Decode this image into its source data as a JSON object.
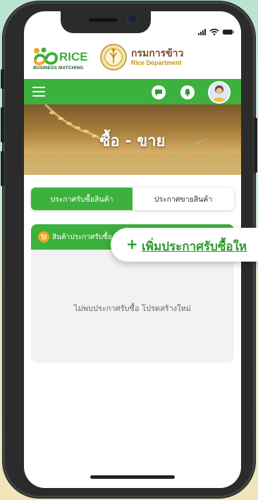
{
  "branding": {
    "rice_word": "RICE",
    "rice_subtitle": "BUSINESS MATCHING",
    "dept_name_th": "กรมการข้าว",
    "dept_name_en": "Rice Department"
  },
  "header": {
    "page_title": "ซื้อ - ขาย"
  },
  "tabs": [
    {
      "label": "ประกาศรับซื้อสินค้า",
      "active": true
    },
    {
      "label": "ประกาศขายสินค้า",
      "active": false
    }
  ],
  "card": {
    "header_label": "สินค้าประกาศรับซื้อ",
    "empty_message": "ไม่พบประกาศรับซื้อ โปรดสร้างใหม่"
  },
  "popup": {
    "plus": "+",
    "label": "เพิ่มประกาศรับซื้อให"
  },
  "colors": {
    "primary_green": "#3db13d",
    "accent_orange": "#f0a623"
  }
}
